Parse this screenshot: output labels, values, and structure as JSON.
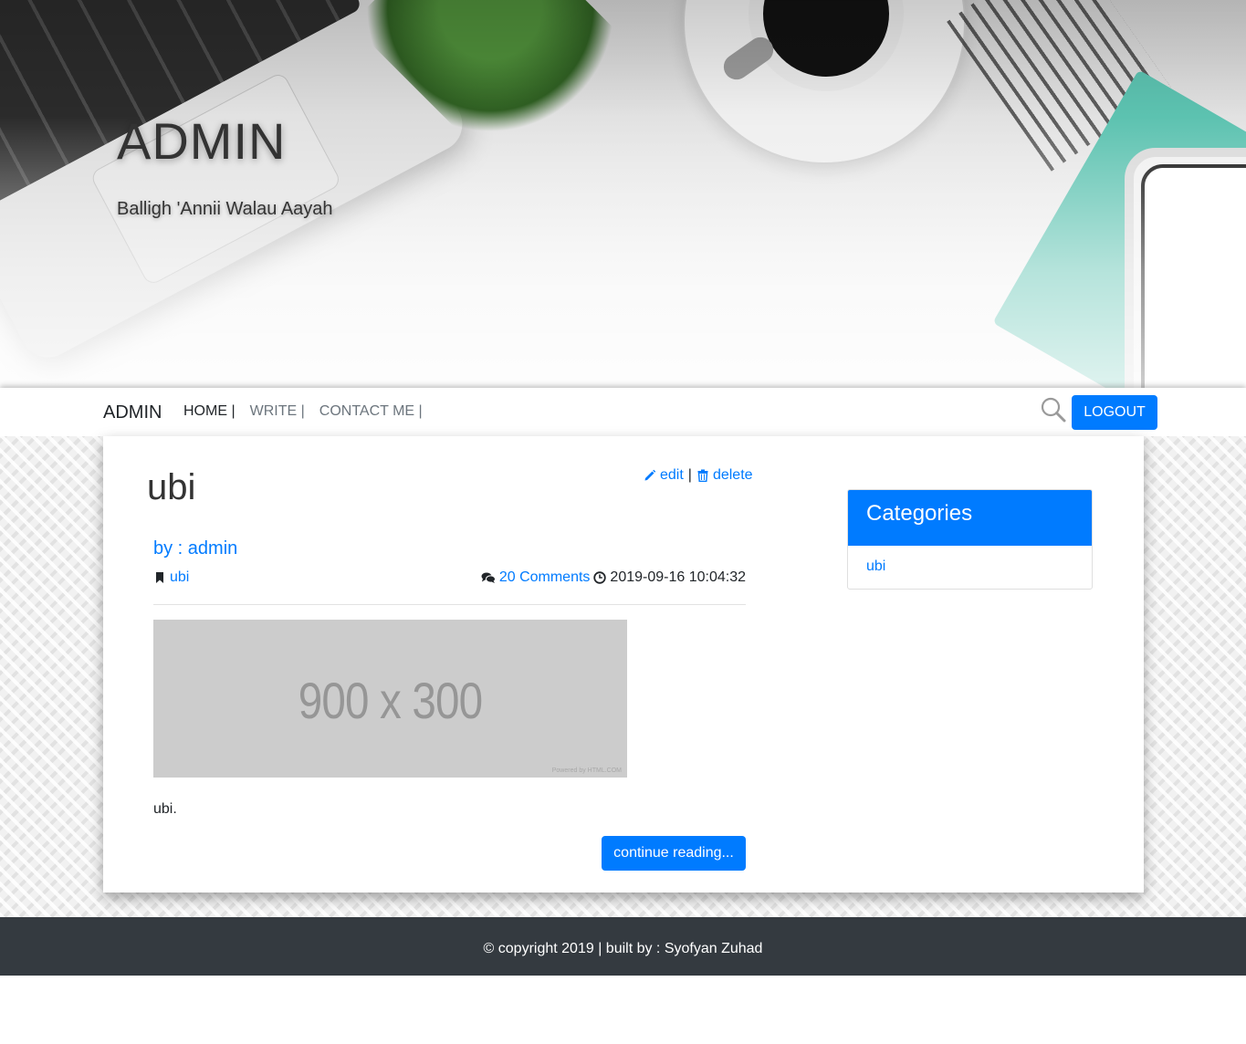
{
  "hero": {
    "title": "ADMIN",
    "subtitle": "Balligh 'Annii Walau Aayah"
  },
  "navbar": {
    "brand": "ADMIN",
    "items": [
      {
        "label": "HOME |",
        "active": true
      },
      {
        "label": "WRITE |",
        "active": false
      },
      {
        "label": "CONTACT ME |",
        "active": false
      }
    ],
    "logout_label": "LOGOUT"
  },
  "post": {
    "title": "ubi",
    "edit_label": "edit",
    "separator": "|",
    "delete_label": "delete",
    "author": "by : admin",
    "category": "ubi",
    "comments": "20 Comments",
    "timestamp": "2019-09-16 10:04:32",
    "image_text": "900 x 300",
    "image_credit": "Powered by HTML.COM",
    "excerpt": "ubi.",
    "continue_label": "continue reading..."
  },
  "sidebar": {
    "categories_title": "Categories",
    "categories": [
      "ubi"
    ]
  },
  "footer": {
    "text": "© copyright 2019 | built by : Syofyan Zuhad"
  },
  "colors": {
    "primary": "#007bff",
    "footer_bg": "#343a40",
    "placeholder_bg": "#cccccc"
  },
  "icons": {
    "edit": "pencil-icon",
    "delete": "trash-icon",
    "category": "bookmark-icon",
    "comments": "comments-icon",
    "time": "clock-icon",
    "search": "search-icon"
  }
}
